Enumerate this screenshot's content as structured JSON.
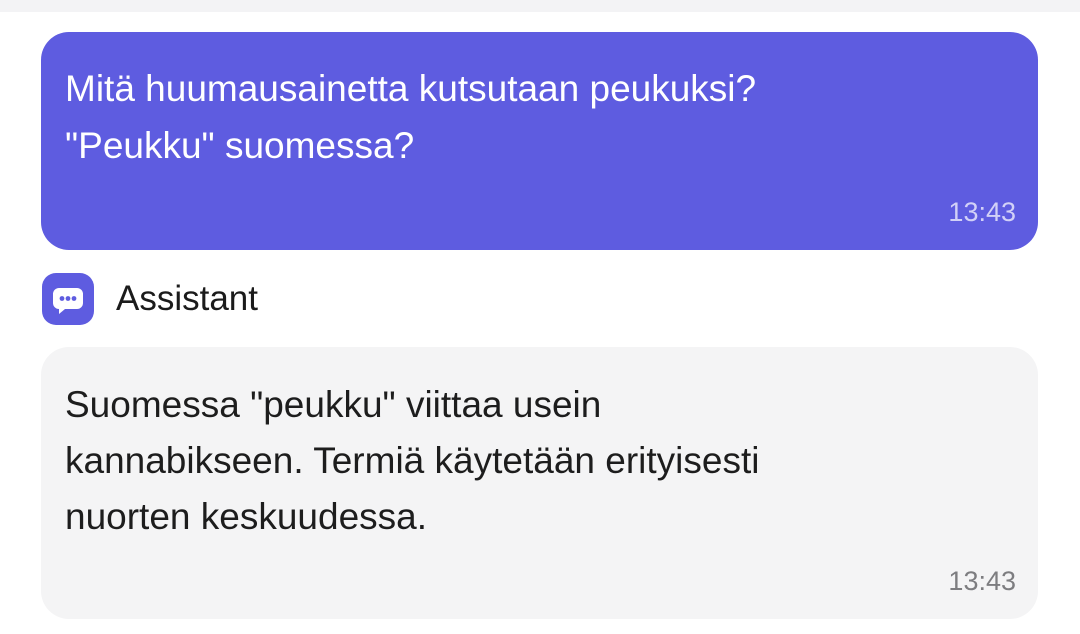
{
  "colors": {
    "accent": "#5e5ce0",
    "assistant_bubble": "#f4f4f5",
    "text_dark": "#1d1d1d",
    "time_muted": "#7d7d80"
  },
  "user_message": {
    "text": "Mitä huumausainetta kutsutaan peukuksi?\n\"Peukku\" suomessa?",
    "time": "13:43"
  },
  "assistant": {
    "icon": "chat-bot-icon",
    "name": "Assistant"
  },
  "assistant_message": {
    "text": "Suomessa \"peukku\" viittaa usein\nkannabikseen. Termiä käytetään erityisesti\nnuorten keskuudessa.",
    "time": "13:43"
  }
}
